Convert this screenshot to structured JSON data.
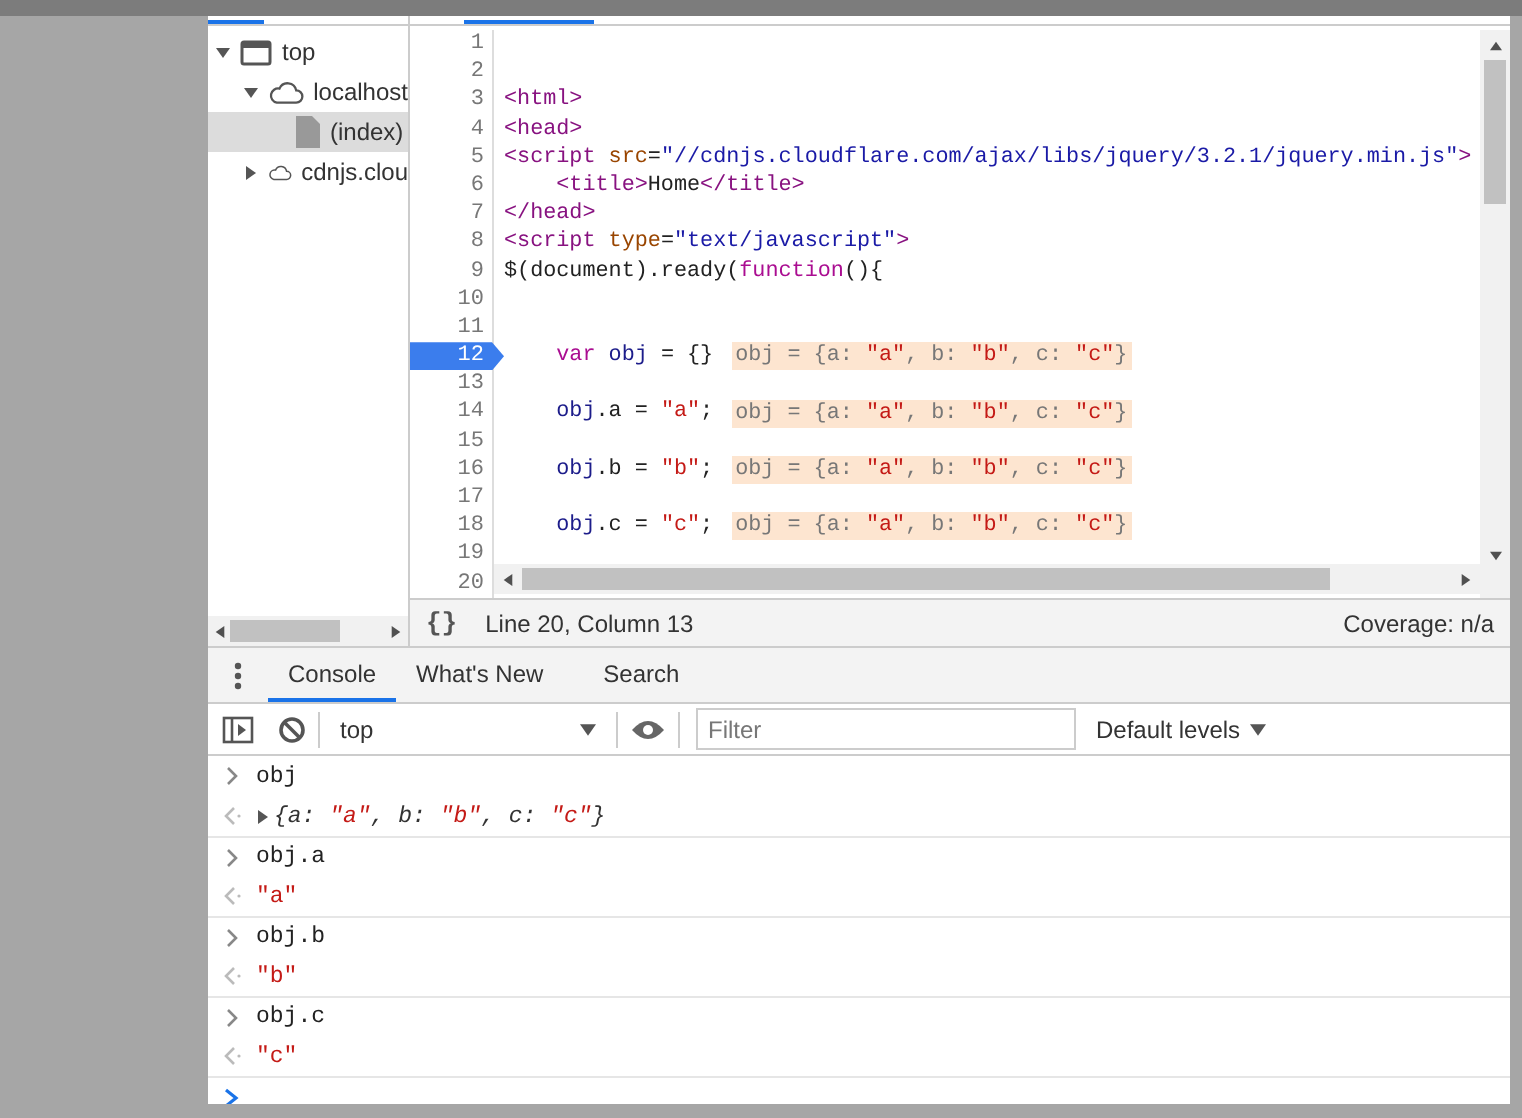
{
  "sidebar": {
    "tree": [
      {
        "label": "top",
        "kind": "frame",
        "expanded": true,
        "selected": false,
        "children": [
          {
            "label": "localhost",
            "kind": "domain",
            "expanded": true,
            "selected": false,
            "children": [
              {
                "label": "(index)",
                "kind": "file",
                "selected": false,
                "highlighted": true
              }
            ]
          },
          {
            "label": "cdnjs.clou",
            "kind": "domain",
            "expanded": false,
            "selected": false
          }
        ]
      }
    ]
  },
  "editor": {
    "lines": [
      {
        "number": "1",
        "current": false
      },
      {
        "number": "2",
        "current": false
      },
      {
        "number": "3",
        "current": false,
        "tokens": [
          {
            "kind": "tag",
            "text": "<html>"
          }
        ]
      },
      {
        "number": "4",
        "current": false,
        "tokens": [
          {
            "kind": "tag",
            "text": "<head>"
          }
        ]
      },
      {
        "number": "5",
        "current": false,
        "tokens": [
          {
            "kind": "tag",
            "text": "<script"
          },
          {
            "kind": "attr",
            "text": " src"
          },
          {
            "kind": "plain",
            "text": "="
          },
          {
            "kind": "value",
            "text": "\"//cdnjs.cloudflare.com/ajax/libs/jquery/3.2.1/jquery.min.js\""
          },
          {
            "kind": "tag",
            "text": ">"
          }
        ]
      },
      {
        "number": "6",
        "current": false,
        "tokens": [
          {
            "kind": "tag",
            "text": "    <title>"
          },
          {
            "kind": "plain",
            "text": "Home"
          },
          {
            "kind": "tag",
            "text": "</title>"
          }
        ]
      },
      {
        "number": "7",
        "current": false,
        "tokens": [
          {
            "kind": "tag",
            "text": "</head>"
          }
        ]
      },
      {
        "number": "8",
        "current": false,
        "tokens": [
          {
            "kind": "tag",
            "text": "<script"
          },
          {
            "kind": "attr",
            "text": " type"
          },
          {
            "kind": "plain",
            "text": "="
          },
          {
            "kind": "value",
            "text": "\"text/javascript\""
          },
          {
            "kind": "tag",
            "text": ">"
          }
        ]
      },
      {
        "number": "9",
        "current": false,
        "tokens": [
          {
            "kind": "plain",
            "text": "$(document).ready("
          },
          {
            "kind": "keyword",
            "text": "function"
          },
          {
            "kind": "plain",
            "text": "(){"
          }
        ]
      },
      {
        "number": "10",
        "current": false
      },
      {
        "number": "11",
        "current": false
      },
      {
        "number": "12",
        "current": true,
        "tokens": [
          {
            "kind": "keyword",
            "text": "    var"
          },
          {
            "kind": "variable",
            "text": " obj"
          },
          {
            "kind": "plain",
            "text": " = {}"
          }
        ],
        "inline_value": "obj = {a: \"a\", b: \"b\", c: \"c\"}"
      },
      {
        "number": "13",
        "current": false
      },
      {
        "number": "14",
        "current": false,
        "tokens": [
          {
            "kind": "variable",
            "text": "    obj"
          },
          {
            "kind": "plain",
            "text": ".a = "
          },
          {
            "kind": "string",
            "text": "\"a\""
          },
          {
            "kind": "plain",
            "text": ";"
          }
        ],
        "inline_value": "obj = {a: \"a\", b: \"b\", c: \"c\"}"
      },
      {
        "number": "15",
        "current": false
      },
      {
        "number": "16",
        "current": false,
        "tokens": [
          {
            "kind": "variable",
            "text": "    obj"
          },
          {
            "kind": "plain",
            "text": ".b = "
          },
          {
            "kind": "string",
            "text": "\"b\""
          },
          {
            "kind": "plain",
            "text": ";"
          }
        ],
        "inline_value": "obj = {a: \"a\", b: \"b\", c: \"c\"}"
      },
      {
        "number": "17",
        "current": false
      },
      {
        "number": "18",
        "current": false,
        "tokens": [
          {
            "kind": "variable",
            "text": "    obj"
          },
          {
            "kind": "plain",
            "text": ".c = "
          },
          {
            "kind": "string",
            "text": "\"c\""
          },
          {
            "kind": "plain",
            "text": ";"
          }
        ],
        "inline_value": "obj = {a: \"a\", b: \"b\", c: \"c\"}"
      },
      {
        "number": "19",
        "current": false
      },
      {
        "number": "20",
        "current": false
      }
    ]
  },
  "status_bar": {
    "format_button": "{}",
    "position": "Line 20, Column 13",
    "coverage": "Coverage: n/a"
  },
  "drawer": {
    "tabs": [
      {
        "label": "Console",
        "selected": true
      },
      {
        "label": "What's New",
        "selected": false
      },
      {
        "label": "Search",
        "selected": false
      }
    ]
  },
  "console_toolbar": {
    "context": "top",
    "filter": {
      "placeholder": "Filter"
    },
    "levels": "Default levels"
  },
  "console": {
    "entries": [
      {
        "kind": "input",
        "text": "obj"
      },
      {
        "kind": "object",
        "text": "{a: \"a\", b: \"b\", c: \"c\"}"
      },
      {
        "kind": "input",
        "text": "obj.a"
      },
      {
        "kind": "result",
        "text": "\"a\""
      },
      {
        "kind": "input",
        "text": "obj.b"
      },
      {
        "kind": "result",
        "text": "\"b\""
      },
      {
        "kind": "input",
        "text": "obj.c"
      },
      {
        "kind": "result",
        "text": "\"c\""
      }
    ]
  }
}
